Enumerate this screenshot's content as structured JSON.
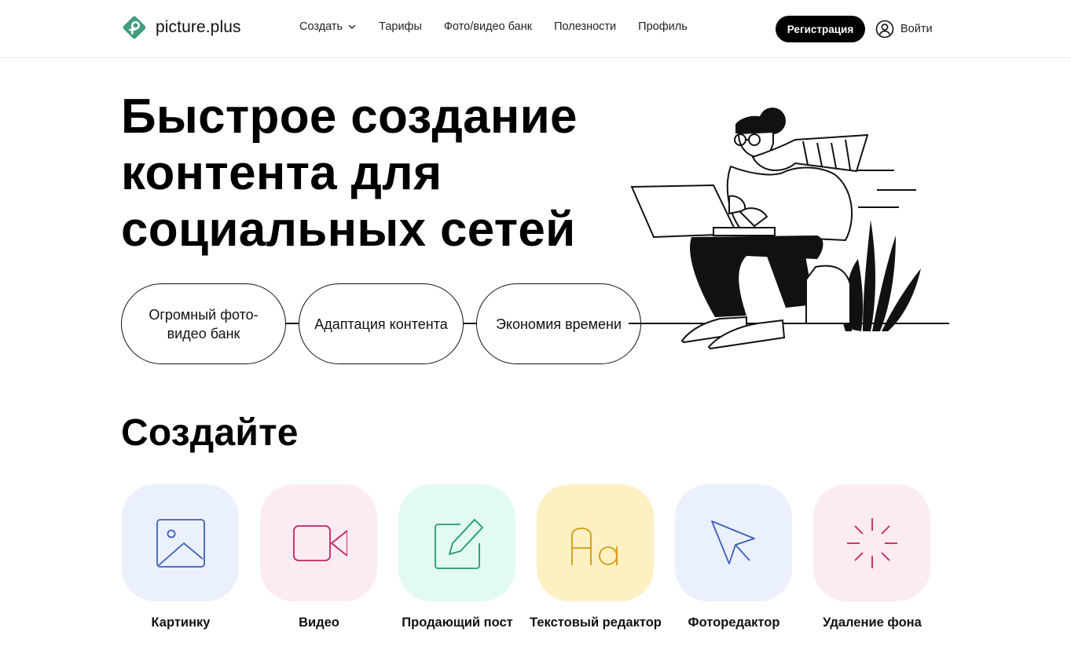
{
  "header": {
    "logo_text": "picture.plus",
    "nav": [
      {
        "label": "Создать",
        "has_dropdown": true
      },
      {
        "label": "Тарифы"
      },
      {
        "label": "Фото/видео банк"
      },
      {
        "label": "Полезности"
      },
      {
        "label": "Профиль"
      }
    ],
    "register_label": "Регистрация",
    "login_label": "Войти"
  },
  "hero": {
    "title": "Быстрое создание контента для социальных сетей",
    "features": [
      "Огромный фото-видео банк",
      "Адаптация контента",
      "Экономия времени"
    ]
  },
  "create": {
    "title": "Создайте",
    "tools": [
      {
        "label": "Картинку",
        "icon": "image-icon",
        "bg": "#ebf0fd",
        "stroke": "#3d5fb8"
      },
      {
        "label": "Видео",
        "icon": "video-camera-icon",
        "bg": "#fdebf4",
        "stroke": "#c4245c"
      },
      {
        "label": "Продающий пост",
        "icon": "edit-icon",
        "bg": "#e3faf1",
        "stroke": "#1f9a6e"
      },
      {
        "label": "Текстовый редактор",
        "icon": "text-icon",
        "bg": "#fdf0c2",
        "stroke": "#d49a12"
      },
      {
        "label": "Фоторедактор",
        "icon": "cursor-icon",
        "bg": "#ebf0fd",
        "stroke": "#3d5fb8"
      },
      {
        "label": "Удаление фона",
        "icon": "sparkle-icon",
        "bg": "#fdebf2",
        "stroke": "#c4245c"
      }
    ]
  },
  "colors": {
    "brand_green": "#3f9e7c",
    "accent_black": "#000000"
  }
}
